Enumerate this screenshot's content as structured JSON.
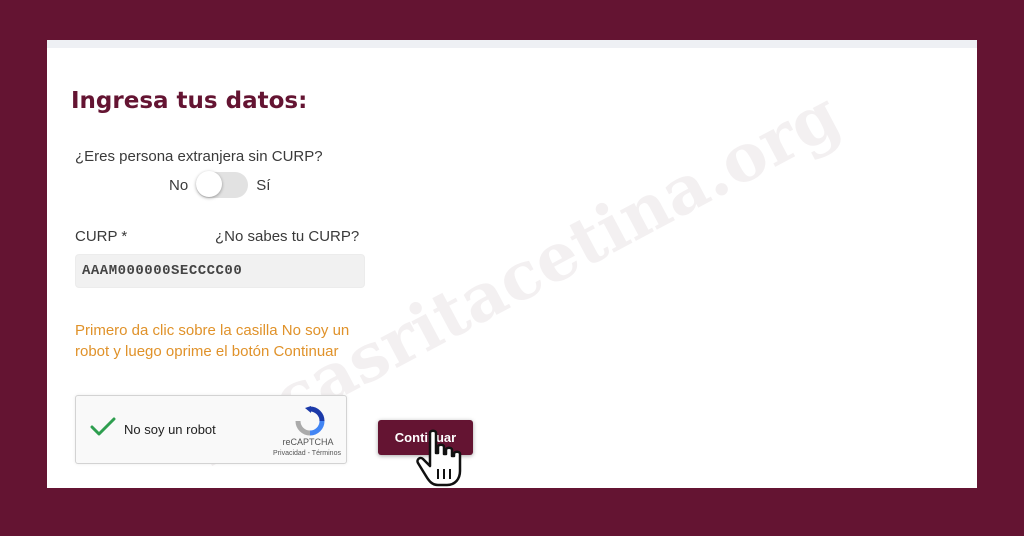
{
  "form": {
    "title": "Ingresa tus datos:",
    "foreign_question": "¿Eres persona extranjera sin CURP?",
    "toggle": {
      "off_label": "No",
      "on_label": "Sí",
      "value": "No"
    },
    "curp_label": "CURP *",
    "curp_help_link": "¿No sabes tu CURP?",
    "curp_value": "AAAM000000SECCCC00",
    "hint": "Primero da clic sobre la casilla No soy un robot y luego oprime el botón Continuar",
    "continue_label": "Continuar"
  },
  "captcha": {
    "label": "No soy un robot",
    "checked": true,
    "brand": "reCAPTCHA",
    "links": "Privacidad - Términos"
  },
  "watermark": "becasritacetina.org",
  "colors": {
    "brand": "#641432",
    "hint": "#e0922a",
    "check": "#2e9e4f"
  }
}
